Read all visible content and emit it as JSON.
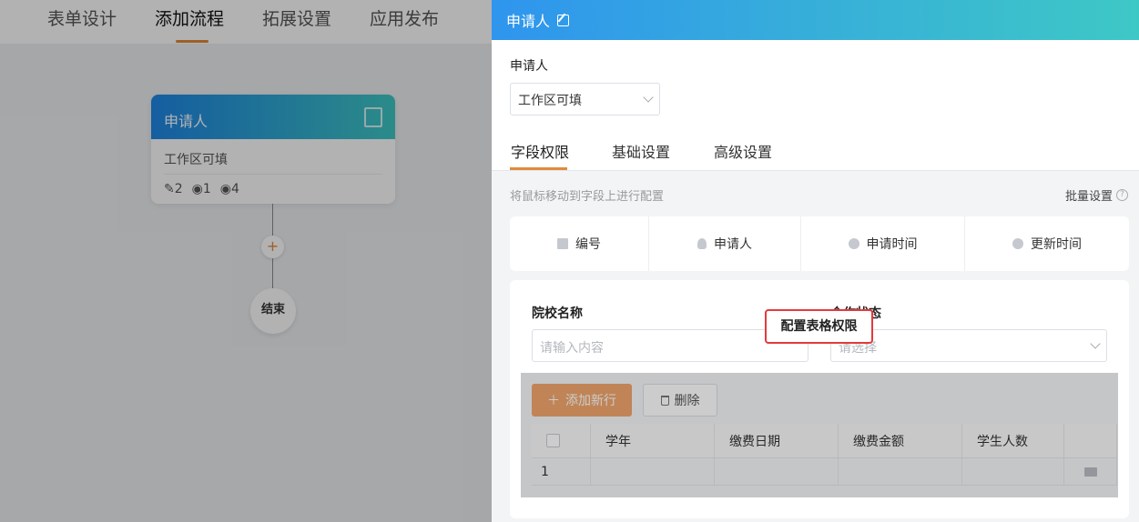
{
  "topnav": {
    "tabs": [
      "表单设计",
      "添加流程",
      "拓展设置",
      "应用发布"
    ],
    "active_tab": "添加流程"
  },
  "flow": {
    "node_title": "申请人",
    "node_subtitle": "工作区可填",
    "stats": {
      "edit": "2",
      "view1": "1",
      "view2": "4"
    },
    "end_label": "结束",
    "add_symbol": "+"
  },
  "drawer": {
    "title": "申请人",
    "applicant_label": "申请人",
    "applicant_select": "工作区可填",
    "tabs": [
      "字段权限",
      "基础设置",
      "高级设置"
    ],
    "active_tab": "字段权限",
    "hint": "将鼠标移动到字段上进行配置",
    "batch_label": "批量设置",
    "batch_help": "?",
    "system_fields": [
      "编号",
      "申请人",
      "申请时间",
      "更新时间"
    ],
    "form": {
      "field1_label": "院校名称",
      "field1_placeholder": "请输入内容",
      "field2_label": "合作状态",
      "field2_placeholder": "请选择"
    },
    "subtable": {
      "add_button": "添加新行",
      "delete_button": "删除",
      "columns": [
        "学年",
        "缴费日期",
        "缴费金额",
        "学生人数"
      ],
      "row_index": "1",
      "config_button": "配置表格权限"
    }
  }
}
